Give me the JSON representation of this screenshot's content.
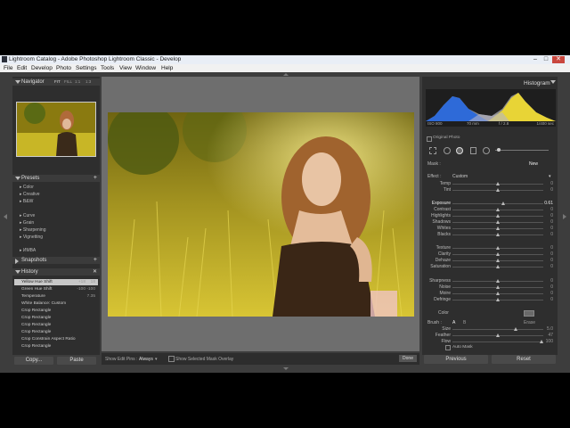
{
  "window": {
    "title": "Lightroom Catalog - Adobe Photoshop Lightroom Classic - Develop"
  },
  "menu": [
    "File",
    "Edit",
    "Develop",
    "Photo",
    "Settings",
    "Tools",
    "View",
    "Window",
    "Help"
  ],
  "left": {
    "navigator": {
      "title": "Navigator",
      "zoom": [
        "FIT",
        "FILL",
        "1:1",
        "1:3"
      ]
    },
    "presets": {
      "title": "Presets",
      "items": [
        "Color",
        "Creative",
        "B&W",
        "Curve",
        "Grain",
        "Sharpening",
        "Vignetting"
      ],
      "user": "ИМВА"
    },
    "snapshots": {
      "title": "Snapshots"
    },
    "history": {
      "title": "History",
      "items": [
        {
          "name": "Yellow Hue Shift",
          "a": "+18",
          "b": "18"
        },
        {
          "name": "Green Hue Shift",
          "a": "-100",
          "b": "-100"
        },
        {
          "name": "Temperature",
          "a": "",
          "b": "7.35"
        },
        {
          "name": "White Balance: Custom",
          "a": "",
          "b": ""
        },
        {
          "name": "Crop Rectangle",
          "a": "",
          "b": ""
        },
        {
          "name": "Crop Rectangle",
          "a": "",
          "b": ""
        },
        {
          "name": "Crop Rectangle",
          "a": "",
          "b": ""
        },
        {
          "name": "Crop Rectangle",
          "a": "",
          "b": ""
        },
        {
          "name": "Crop Constrain Aspect Ratio",
          "a": "",
          "b": ""
        },
        {
          "name": "Crop Rectangle",
          "a": "",
          "b": ""
        }
      ]
    },
    "copy_label": "Copy...",
    "paste_label": "Paste"
  },
  "toolbar": {
    "show_pins_label": "Show Edit Pins :",
    "show_pins_value": "Always",
    "mask_overlay_label": "Show Selected Mask Overlay",
    "done_label": "Done"
  },
  "right": {
    "histogram": {
      "title": "Histogram",
      "iso": "ISO 800",
      "focal": "70 mm",
      "aperture": "f / 2.8",
      "shutter": "1/400 sec",
      "original_photo": "Original Photo"
    },
    "mask": {
      "label": "Mask :",
      "value": "New"
    },
    "effect": {
      "label": "Effect :",
      "value": "Custom"
    },
    "sliders": [
      {
        "name": "Temp",
        "value": "0",
        "pos": 0.5
      },
      {
        "name": "Tint",
        "value": "0",
        "pos": 0.5
      },
      {
        "name": "Exposure",
        "value": "0.61",
        "pos": 0.56
      },
      {
        "name": "Contrast",
        "value": "0",
        "pos": 0.5
      },
      {
        "name": "Highlights",
        "value": "0",
        "pos": 0.5
      },
      {
        "name": "Shadows",
        "value": "0",
        "pos": 0.5
      },
      {
        "name": "Whites",
        "value": "0",
        "pos": 0.5
      },
      {
        "name": "Blacks",
        "value": "0",
        "pos": 0.5
      },
      {
        "name": "Texture",
        "value": "0",
        "pos": 0.5
      },
      {
        "name": "Clarity",
        "value": "0",
        "pos": 0.5
      },
      {
        "name": "Dehaze",
        "value": "0",
        "pos": 0.5
      },
      {
        "name": "Saturation",
        "value": "0",
        "pos": 0.5
      },
      {
        "name": "Sharpness",
        "value": "0",
        "pos": 0.5
      },
      {
        "name": "Noise",
        "value": "0",
        "pos": 0.5
      },
      {
        "name": "Moire",
        "value": "0",
        "pos": 0.5
      },
      {
        "name": "Defringe",
        "value": "0",
        "pos": 0.5
      }
    ],
    "color_label": "Color",
    "brush": {
      "label": "Brush :",
      "a": "A",
      "b": "B",
      "erase": "Erase",
      "rows": [
        {
          "name": "Size",
          "value": "5.0"
        },
        {
          "name": "Feather",
          "value": "47"
        },
        {
          "name": "Flow",
          "value": "100"
        }
      ],
      "automask": "Auto Mask"
    },
    "previous_label": "Previous",
    "reset_label": "Reset"
  }
}
